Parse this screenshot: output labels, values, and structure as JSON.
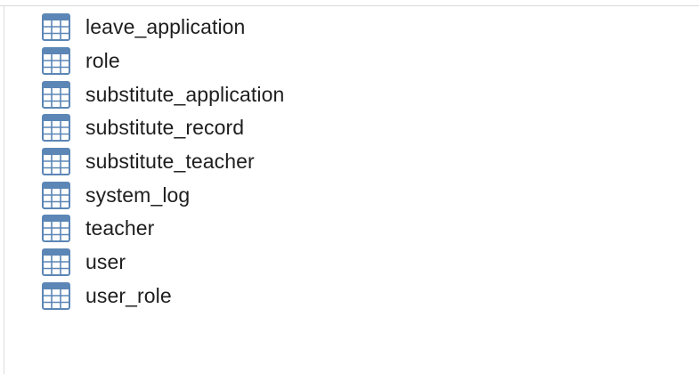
{
  "table_list": {
    "icon": "table-grid-icon",
    "icon_color": "#5b86b5",
    "items": [
      {
        "label": "leave_application"
      },
      {
        "label": "role"
      },
      {
        "label": "substitute_application"
      },
      {
        "label": "substitute_record"
      },
      {
        "label": "substitute_teacher"
      },
      {
        "label": "system_log"
      },
      {
        "label": "teacher"
      },
      {
        "label": "user"
      },
      {
        "label": "user_role"
      }
    ]
  }
}
